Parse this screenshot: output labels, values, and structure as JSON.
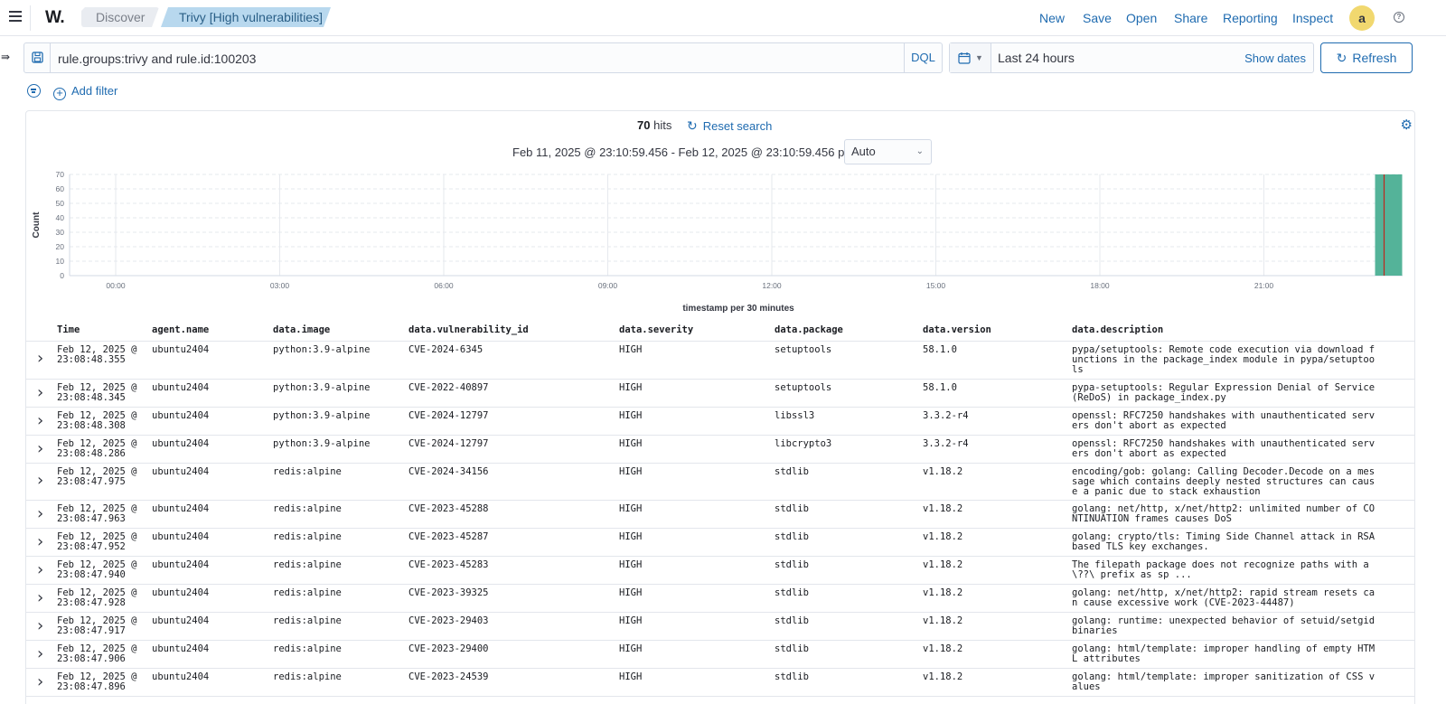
{
  "header": {
    "logo": "W.",
    "breadcrumbs": [
      "Discover",
      "Trivy [High vulnerabilities]"
    ],
    "links": [
      "New",
      "Save",
      "Open",
      "Share",
      "Reporting",
      "Inspect"
    ],
    "avatar_letter": "a"
  },
  "query": {
    "text": "rule.groups:trivy and rule.id:100203",
    "language": "DQL"
  },
  "time": {
    "label": "Last 24 hours",
    "show_dates": "Show dates",
    "refresh": "Refresh"
  },
  "filters": {
    "add_filter": "Add filter"
  },
  "results": {
    "hits_count": "70",
    "hits_label": "hits",
    "reset_search": "Reset search",
    "range": "Feb 11, 2025 @ 23:10:59.456 - Feb 12, 2025 @ 23:10:59.456 per",
    "interval": "Auto"
  },
  "colors": {
    "accent": "#1f6bb0",
    "bar": "#54b399",
    "marker": "#bd271e"
  },
  "chart_data": {
    "type": "bar",
    "ylabel": "Count",
    "xlabel": "timestamp per 30 minutes",
    "ylim": [
      0,
      70
    ],
    "yticks": [
      0,
      10,
      20,
      30,
      40,
      50,
      60,
      70
    ],
    "x_tick_labels": [
      "00:00",
      "03:00",
      "06:00",
      "09:00",
      "12:00",
      "15:00",
      "18:00",
      "21:00"
    ],
    "bars": [
      {
        "x": "23:00",
        "value": 70
      }
    ],
    "grid": true
  },
  "table": {
    "columns": [
      "Time",
      "agent.name",
      "data.image",
      "data.vulnerability_id",
      "data.severity",
      "data.package",
      "data.version",
      "data.description"
    ],
    "rows": [
      {
        "time": "Feb 12, 2025 @ 23:08:48.355",
        "agent": "ubuntu2404",
        "image": "python:3.9-alpine",
        "vuln": "CVE-2024-6345",
        "severity": "HIGH",
        "package": "setuptools",
        "version": "58.1.0",
        "description": "pypa/setuptools: Remote code execution via download functions in the package_index module in pypa/setuptools"
      },
      {
        "time": "Feb 12, 2025 @ 23:08:48.345",
        "agent": "ubuntu2404",
        "image": "python:3.9-alpine",
        "vuln": "CVE-2022-40897",
        "severity": "HIGH",
        "package": "setuptools",
        "version": "58.1.0",
        "description": "pypa-setuptools: Regular Expression Denial of Service (ReDoS) in package_index.py"
      },
      {
        "time": "Feb 12, 2025 @ 23:08:48.308",
        "agent": "ubuntu2404",
        "image": "python:3.9-alpine",
        "vuln": "CVE-2024-12797",
        "severity": "HIGH",
        "package": "libssl3",
        "version": "3.3.2-r4",
        "description": "openssl: RFC7250 handshakes with unauthenticated servers don't abort as expected"
      },
      {
        "time": "Feb 12, 2025 @ 23:08:48.286",
        "agent": "ubuntu2404",
        "image": "python:3.9-alpine",
        "vuln": "CVE-2024-12797",
        "severity": "HIGH",
        "package": "libcrypto3",
        "version": "3.3.2-r4",
        "description": "openssl: RFC7250 handshakes with unauthenticated servers don't abort as expected"
      },
      {
        "time": "Feb 12, 2025 @ 23:08:47.975",
        "agent": "ubuntu2404",
        "image": "redis:alpine",
        "vuln": "CVE-2024-34156",
        "severity": "HIGH",
        "package": "stdlib",
        "version": "v1.18.2",
        "description": "encoding/gob: golang: Calling Decoder.Decode on a message which contains deeply nested structures can cause a panic due to stack exhaustion"
      },
      {
        "time": "Feb 12, 2025 @ 23:08:47.963",
        "agent": "ubuntu2404",
        "image": "redis:alpine",
        "vuln": "CVE-2023-45288",
        "severity": "HIGH",
        "package": "stdlib",
        "version": "v1.18.2",
        "description": "golang: net/http, x/net/http2: unlimited number of CONTINUATION frames causes DoS"
      },
      {
        "time": "Feb 12, 2025 @ 23:08:47.952",
        "agent": "ubuntu2404",
        "image": "redis:alpine",
        "vuln": "CVE-2023-45287",
        "severity": "HIGH",
        "package": "stdlib",
        "version": "v1.18.2",
        "description": "golang: crypto/tls: Timing Side Channel attack in RSA based TLS key exchanges."
      },
      {
        "time": "Feb 12, 2025 @ 23:08:47.940",
        "agent": "ubuntu2404",
        "image": "redis:alpine",
        "vuln": "CVE-2023-45283",
        "severity": "HIGH",
        "package": "stdlib",
        "version": "v1.18.2",
        "description": "The filepath package does not recognize paths with a \\??\\ prefix as sp ..."
      },
      {
        "time": "Feb 12, 2025 @ 23:08:47.928",
        "agent": "ubuntu2404",
        "image": "redis:alpine",
        "vuln": "CVE-2023-39325",
        "severity": "HIGH",
        "package": "stdlib",
        "version": "v1.18.2",
        "description": "golang: net/http, x/net/http2: rapid stream resets can cause excessive work (CVE-2023-44487)"
      },
      {
        "time": "Feb 12, 2025 @ 23:08:47.917",
        "agent": "ubuntu2404",
        "image": "redis:alpine",
        "vuln": "CVE-2023-29403",
        "severity": "HIGH",
        "package": "stdlib",
        "version": "v1.18.2",
        "description": "golang: runtime: unexpected behavior of setuid/setgid binaries"
      },
      {
        "time": "Feb 12, 2025 @ 23:08:47.906",
        "agent": "ubuntu2404",
        "image": "redis:alpine",
        "vuln": "CVE-2023-29400",
        "severity": "HIGH",
        "package": "stdlib",
        "version": "v1.18.2",
        "description": "golang: html/template: improper handling of empty HTML attributes"
      },
      {
        "time": "Feb 12, 2025 @ 23:08:47.896",
        "agent": "ubuntu2404",
        "image": "redis:alpine",
        "vuln": "CVE-2023-24539",
        "severity": "HIGH",
        "package": "stdlib",
        "version": "v1.18.2",
        "description": "golang: html/template: improper sanitization of CSS values"
      }
    ]
  }
}
